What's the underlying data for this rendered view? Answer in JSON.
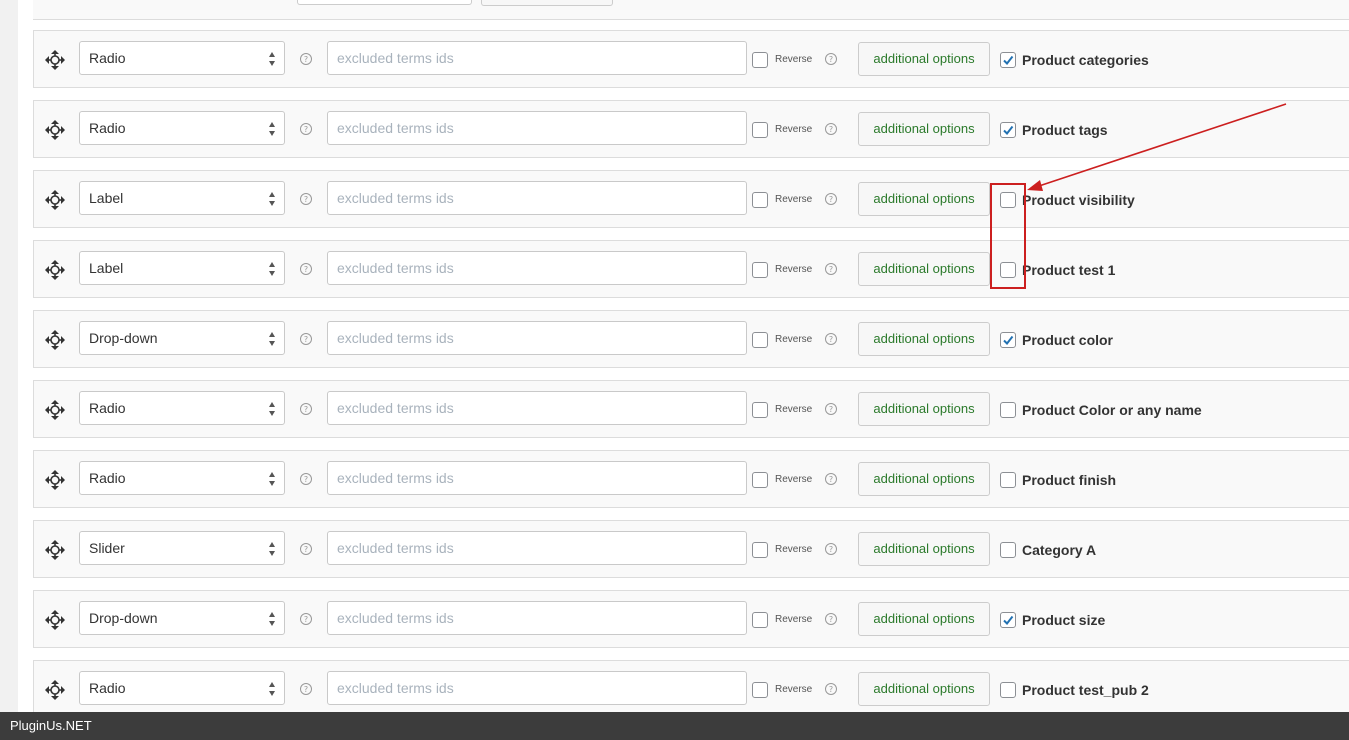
{
  "footer": {
    "brand": "PluginUs.NET"
  },
  "labels": {
    "placeholder": "excluded terms ids",
    "reverse": "Reverse",
    "additional": "additional options"
  },
  "colors": {
    "accent_check": "#2271b1",
    "annotation": "#cc1f1f",
    "button_text": "#2b7a2b"
  },
  "rows": [
    {
      "type": "Radio",
      "taxonomy": "Product categories",
      "checked": true
    },
    {
      "type": "Radio",
      "taxonomy": "Product tags",
      "checked": true
    },
    {
      "type": "Label",
      "taxonomy": "Product visibility",
      "checked": false
    },
    {
      "type": "Label",
      "taxonomy": "Product test 1",
      "checked": false
    },
    {
      "type": "Drop-down",
      "taxonomy": "Product color",
      "checked": true
    },
    {
      "type": "Radio",
      "taxonomy": "Product Color or any name",
      "checked": false
    },
    {
      "type": "Radio",
      "taxonomy": "Product finish",
      "checked": false
    },
    {
      "type": "Slider",
      "taxonomy": "Category A",
      "checked": false
    },
    {
      "type": "Drop-down",
      "taxonomy": "Product size",
      "checked": true
    },
    {
      "type": "Radio",
      "taxonomy": "Product test_pub 2",
      "checked": false
    }
  ]
}
